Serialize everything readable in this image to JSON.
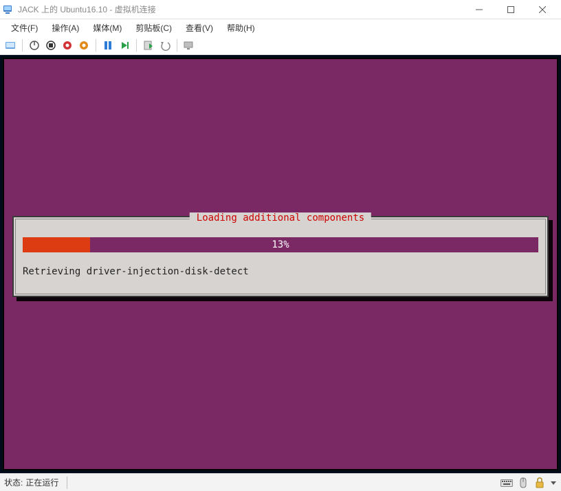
{
  "window": {
    "title": "JACK 上的 Ubuntu16.10 - 虚拟机连接"
  },
  "menu": {
    "file": "文件(F)",
    "action": "操作(A)",
    "media": "媒体(M)",
    "clipboard": "剪贴板(C)",
    "view": "查看(V)",
    "help": "帮助(H)"
  },
  "installer": {
    "title": "Loading additional components",
    "progress_percent": 13,
    "progress_label": "13%",
    "status_text": "Retrieving driver-injection-disk-detect"
  },
  "statusbar": {
    "label": "状态:",
    "value": "正在运行"
  },
  "colors": {
    "ubuntu_bg": "#7b2965",
    "progress_fill": "#dd3b12",
    "legend_red": "#cc0000"
  }
}
